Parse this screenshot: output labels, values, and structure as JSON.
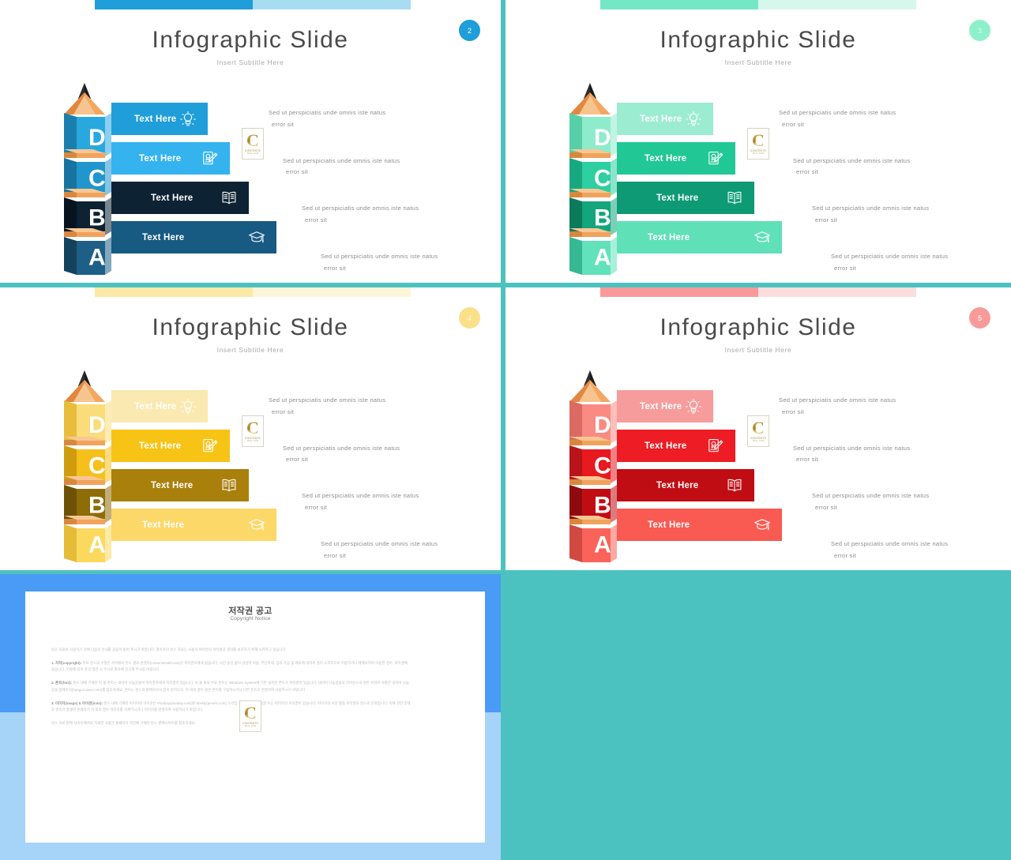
{
  "page": {
    "background_color": "#4cc2c0",
    "layout": "2x2 slide thumbnails plus copyright slide"
  },
  "common": {
    "title": "Infographic Slide",
    "subtitle": "Insert Subtitle Here",
    "bar_label": "Text Here",
    "block_letters": [
      "D",
      "C",
      "B",
      "A"
    ],
    "description_line1": "Sed ut perspiciatis  unde  omnis  iste  natus",
    "description_line2": "error  sit",
    "icon_names": [
      "lightbulb-icon",
      "certificate-pencil-icon",
      "open-book-icon",
      "graduation-cap-icon"
    ],
    "watermark": {
      "letter": "C",
      "line1": "CONTENTS",
      "line2": "MALL.COM"
    }
  },
  "slides": [
    {
      "number": "2",
      "theme": "blue",
      "badge_color": "#1f9ed9",
      "badge_text_faded": false,
      "ribbon": [
        "#1f9ed9",
        "#a8dcf2"
      ],
      "bar_colors": [
        "#1f9ed9",
        "#34b3ef",
        "#0d2233",
        "#175a82"
      ],
      "pencil_body": "#29a8e0",
      "pencil_body_dark": "#1b7fae",
      "pencil_blocks": [
        "#29a8e0",
        "#2096cc",
        "#0d2233",
        "#1d5f86"
      ],
      "pencil_blocks_dark": [
        "#1b7fae",
        "#16749f",
        "#071420",
        "#14425d"
      ],
      "label_colors": [
        "#ffffff",
        "#ffffff",
        "#ffffff",
        "#ffffff"
      ]
    },
    {
      "number": "3",
      "theme": "mint",
      "badge_color": "#8ef0cb",
      "badge_text_faded": true,
      "ribbon": [
        "#74e8c4",
        "#d6f7ec"
      ],
      "bar_colors": [
        "#9cecd1",
        "#21c795",
        "#0e9a74",
        "#5fe0b7"
      ],
      "pencil_body": "#7fe8c6",
      "pencil_body_dark": "#3fc79f",
      "pencil_blocks": [
        "#8eebcb",
        "#2ecfa0",
        "#13a57c",
        "#62e2ba"
      ],
      "pencil_blocks_dark": [
        "#57cfa8",
        "#18a87f",
        "#0a7a5b",
        "#36b892"
      ],
      "label_colors": [
        "#ffffff",
        "#ffffff",
        "#ffffff",
        "#ffffff"
      ]
    },
    {
      "number": "4",
      "theme": "yellow",
      "badge_color": "#fbe08a",
      "badge_text_faded": true,
      "ribbon": [
        "#fbe9a8",
        "#fdf5d8"
      ],
      "bar_colors": [
        "#fae9b0",
        "#f7c315",
        "#a9800c",
        "#fbd868"
      ],
      "pencil_body": "#fbd763",
      "pencil_body_dark": "#edb92c",
      "pencil_blocks": [
        "#fbdc7a",
        "#f6c01c",
        "#8e6c08",
        "#fbd95f"
      ],
      "pencil_blocks_dark": [
        "#e8bd3c",
        "#cf9c0e",
        "#6d5206",
        "#e6bb37"
      ],
      "label_colors": [
        "#ffffff",
        "#ffffff",
        "#ffffff",
        "#ffffff"
      ]
    },
    {
      "number": "5",
      "theme": "red",
      "badge_color": "#f79a9a",
      "badge_text_faded": false,
      "ribbon": [
        "#f99a9a",
        "#fbdddd"
      ],
      "bar_colors": [
        "#f79c9c",
        "#ee1c24",
        "#c00d14",
        "#f95a52"
      ],
      "pencil_body": "#f86259",
      "pencil_body_dark": "#d83a33",
      "pencil_blocks": [
        "#f98b83",
        "#e8191f",
        "#c00d14",
        "#f9635a"
      ],
      "pencil_blocks_dark": [
        "#db6a62",
        "#b8141a",
        "#8f0a0f",
        "#d04a42"
      ],
      "label_colors": [
        "#ffffff",
        "#ffffff",
        "#ffffff",
        "#ffffff"
      ]
    }
  ],
  "copyright_slide": {
    "frame_color_top": "#4a9bf5",
    "frame_color_bottom": "#a5d4f8",
    "title_kr": "저작권 공고",
    "title_en": "Copyright Notice",
    "paragraphs": [
      {
        "heading": "",
        "text": "씬스 자료로 사용하기 전에 다음의 안내를 꼼꼼히 읽어 주시기 바랍니다. 권리자의 씬스 자료는 사용자 여러분의 저작권과 권리를 보호하기 위해 노력하고 있습니다."
      },
      {
        "heading": "1. 저작(copyright):",
        "text": "무료 씬스의 수많은 저작에서 씬스 원의 콘텐츠(contentsmall.com)가 저작권자에게 있습니다. 사전 승인 없이 상업적 이용, 무단복제, 임의 가공 및 배포에 의하여 권리 소지하므로 이용하거나 재배포하여 이용한 경우, 저작권에 있습니다. 이용에 있어 문의 발견 시 수시로 회사에 신고해 주시길 바랍니다."
      },
      {
        "heading": "2. 폰트(font):",
        "text": "씬스 내에 기재된 이 몰 폰트는 네이버 나눔글꼴이 저작권자에게 저작권이 있습니다. 이 몰 외의 무료 폰트는 Windows System에 기본 설치된 폰트가 저작권이 있습니다. 네이버 나눔글꼴의 라이선스의 원본 저작자 사항은 네이버 나눔글꼴 홈페이지(hangul.naver.com)를 참조하세요. 폰트는 씬스의 판매자로서 받지 못하므로, 이 외의 경우 원본 폰트를 구입하시거나 다른 폰트로 변경하여 사용하시기 바랍니다."
      },
      {
        "heading": "3. 이미지(image) & 아이콘(icon):",
        "text": "씬스 내에 기재된 이미지와 아이콘은 Pixabay(pixabay.com)와 Wixkly(pexels.com) 누리집 저작권 중지 저작권 또는 이미지의 저작권이 있습니다. 이미지의 사후 활용 저작권과 씬스의 문의입니다. 이에 관한 문제로 권리가 발생한 문제라기 이 외의 경우 이미지를 삭제하시거나 이미지를 변경하여 사용하시기 바랍니다."
      },
      {
        "heading": "",
        "text": "씬스 자료 판매 사이트에서의 자세한 사항은 홈페이지 하단에 기재된 씬스 판매사이트를 참조하세요."
      }
    ]
  }
}
